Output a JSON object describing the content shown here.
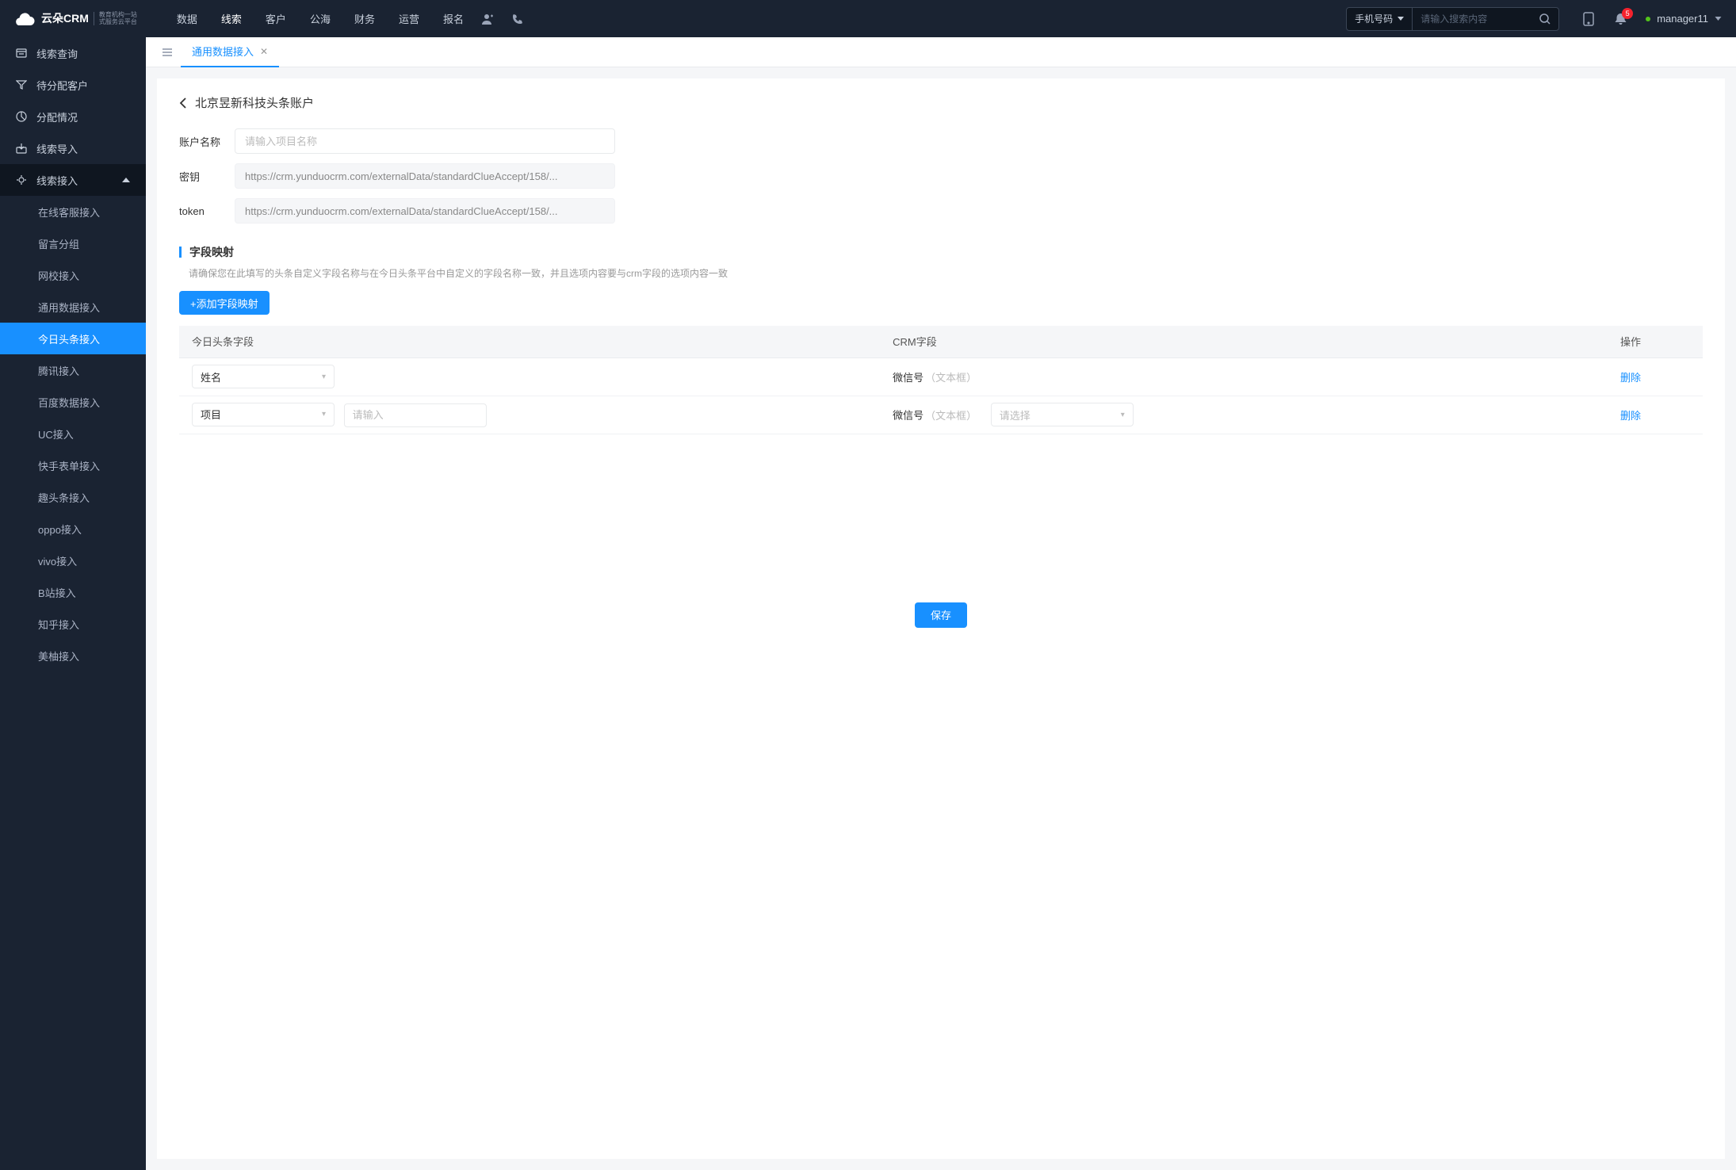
{
  "header": {
    "logo_main": "云朵CRM",
    "logo_sub1": "教育机构一站",
    "logo_sub2": "式服务云平台",
    "nav": [
      "数据",
      "线索",
      "客户",
      "公海",
      "财务",
      "运营",
      "报名"
    ],
    "nav_active": 1,
    "search_type": "手机号码",
    "search_placeholder": "请输入搜索内容",
    "notif_count": "5",
    "user": "manager11"
  },
  "sidebar": {
    "items": [
      {
        "label": "线索查询"
      },
      {
        "label": "待分配客户"
      },
      {
        "label": "分配情况"
      },
      {
        "label": "线索导入"
      },
      {
        "label": "线索接入",
        "expanded": true,
        "children": [
          {
            "label": "在线客服接入"
          },
          {
            "label": "留言分组"
          },
          {
            "label": "网校接入"
          },
          {
            "label": "通用数据接入"
          },
          {
            "label": "今日头条接入",
            "active": true
          },
          {
            "label": "腾讯接入"
          },
          {
            "label": "百度数据接入"
          },
          {
            "label": "UC接入"
          },
          {
            "label": "快手表单接入"
          },
          {
            "label": "趣头条接入"
          },
          {
            "label": "oppo接入"
          },
          {
            "label": "vivo接入"
          },
          {
            "label": "B站接入"
          },
          {
            "label": "知乎接入"
          },
          {
            "label": "美柚接入"
          }
        ]
      }
    ]
  },
  "tab": {
    "label": "通用数据接入"
  },
  "page": {
    "title": "北京昱新科技头条账户",
    "form": {
      "name_label": "账户名称",
      "name_placeholder": "请输入项目名称",
      "secret_label": "密钥",
      "secret_value": "https://crm.yunduocrm.com/externalData/standardClueAccept/158/...",
      "token_label": "token",
      "token_value": "https://crm.yunduocrm.com/externalData/standardClueAccept/158/..."
    },
    "mapping": {
      "section_title": "字段映射",
      "hint": "请确保您在此填写的头条自定义字段名称与在今日头条平台中自定义的字段名称一致，并且选项内容要与crm字段的选项内容一致",
      "add_btn": "+添加字段映射",
      "cols": {
        "c1": "今日头条字段",
        "c2": "CRM字段",
        "c3": "操作"
      },
      "rows": [
        {
          "tt_field": "姓名",
          "crm_field": "微信号",
          "crm_type": "（文本框）",
          "del": "删除"
        },
        {
          "tt_field": "项目",
          "extra_ph": "请输入",
          "crm_field": "微信号",
          "crm_type": "（文本框）",
          "extra_sel_ph": "请选择",
          "del": "删除"
        }
      ]
    },
    "save_btn": "保存"
  }
}
